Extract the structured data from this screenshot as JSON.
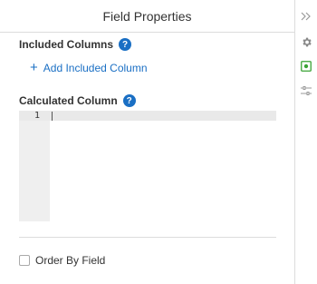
{
  "panel": {
    "title": "Field Properties"
  },
  "included_columns": {
    "heading": "Included Columns",
    "help": "?",
    "add_label": "Add Included Column",
    "add_icon": "+"
  },
  "calculated_column": {
    "heading": "Calculated Column",
    "help": "?",
    "line_number": "1"
  },
  "order_by": {
    "label": "Order By Field",
    "checked": false
  },
  "rail": {
    "items": [
      {
        "icon": "double-chevron-right-icon"
      },
      {
        "icon": "gear-icon"
      },
      {
        "icon": "field-properties-icon",
        "active": true
      },
      {
        "icon": "sliders-icon"
      }
    ]
  },
  "colors": {
    "accent": "#1a6fc4",
    "active_green": "#3aa335"
  }
}
